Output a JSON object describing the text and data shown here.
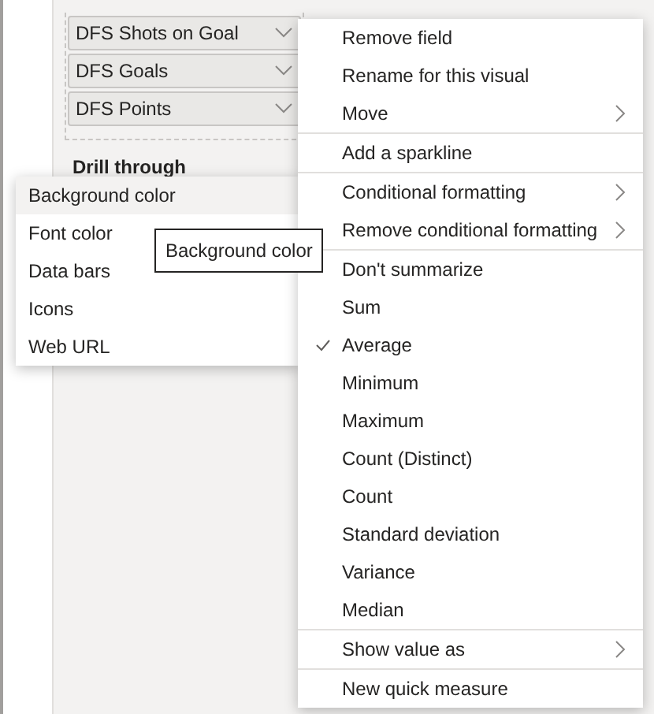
{
  "fields": [
    {
      "name": "DFS Shots on Goal"
    },
    {
      "name": "DFS Goals"
    },
    {
      "name": "DFS Points"
    }
  ],
  "drill_through": {
    "title": "Drill through"
  },
  "submenu": [
    {
      "label": "Background color",
      "selected": true
    },
    {
      "label": "Font color",
      "selected": false
    },
    {
      "label": "Data bars",
      "selected": false
    },
    {
      "label": "Icons",
      "selected": false
    },
    {
      "label": "Web URL",
      "selected": false
    }
  ],
  "tooltip": "Background color",
  "context_menu": [
    [
      {
        "label": "Remove field",
        "submenu": false,
        "checked": false
      },
      {
        "label": "Rename for this visual",
        "submenu": false,
        "checked": false
      },
      {
        "label": "Move",
        "submenu": true,
        "checked": false
      }
    ],
    [
      {
        "label": "Add a sparkline",
        "submenu": false,
        "checked": false
      }
    ],
    [
      {
        "label": "Conditional formatting",
        "submenu": true,
        "checked": false
      },
      {
        "label": "Remove conditional formatting",
        "submenu": true,
        "checked": false
      }
    ],
    [
      {
        "label": "Don't summarize",
        "submenu": false,
        "checked": false
      },
      {
        "label": "Sum",
        "submenu": false,
        "checked": false
      },
      {
        "label": "Average",
        "submenu": false,
        "checked": true
      },
      {
        "label": "Minimum",
        "submenu": false,
        "checked": false
      },
      {
        "label": "Maximum",
        "submenu": false,
        "checked": false
      },
      {
        "label": "Count (Distinct)",
        "submenu": false,
        "checked": false
      },
      {
        "label": "Count",
        "submenu": false,
        "checked": false
      },
      {
        "label": "Standard deviation",
        "submenu": false,
        "checked": false
      },
      {
        "label": "Variance",
        "submenu": false,
        "checked": false
      },
      {
        "label": "Median",
        "submenu": false,
        "checked": false
      }
    ],
    [
      {
        "label": "Show value as",
        "submenu": true,
        "checked": false
      }
    ],
    [
      {
        "label": "New quick measure",
        "submenu": false,
        "checked": false
      }
    ]
  ]
}
